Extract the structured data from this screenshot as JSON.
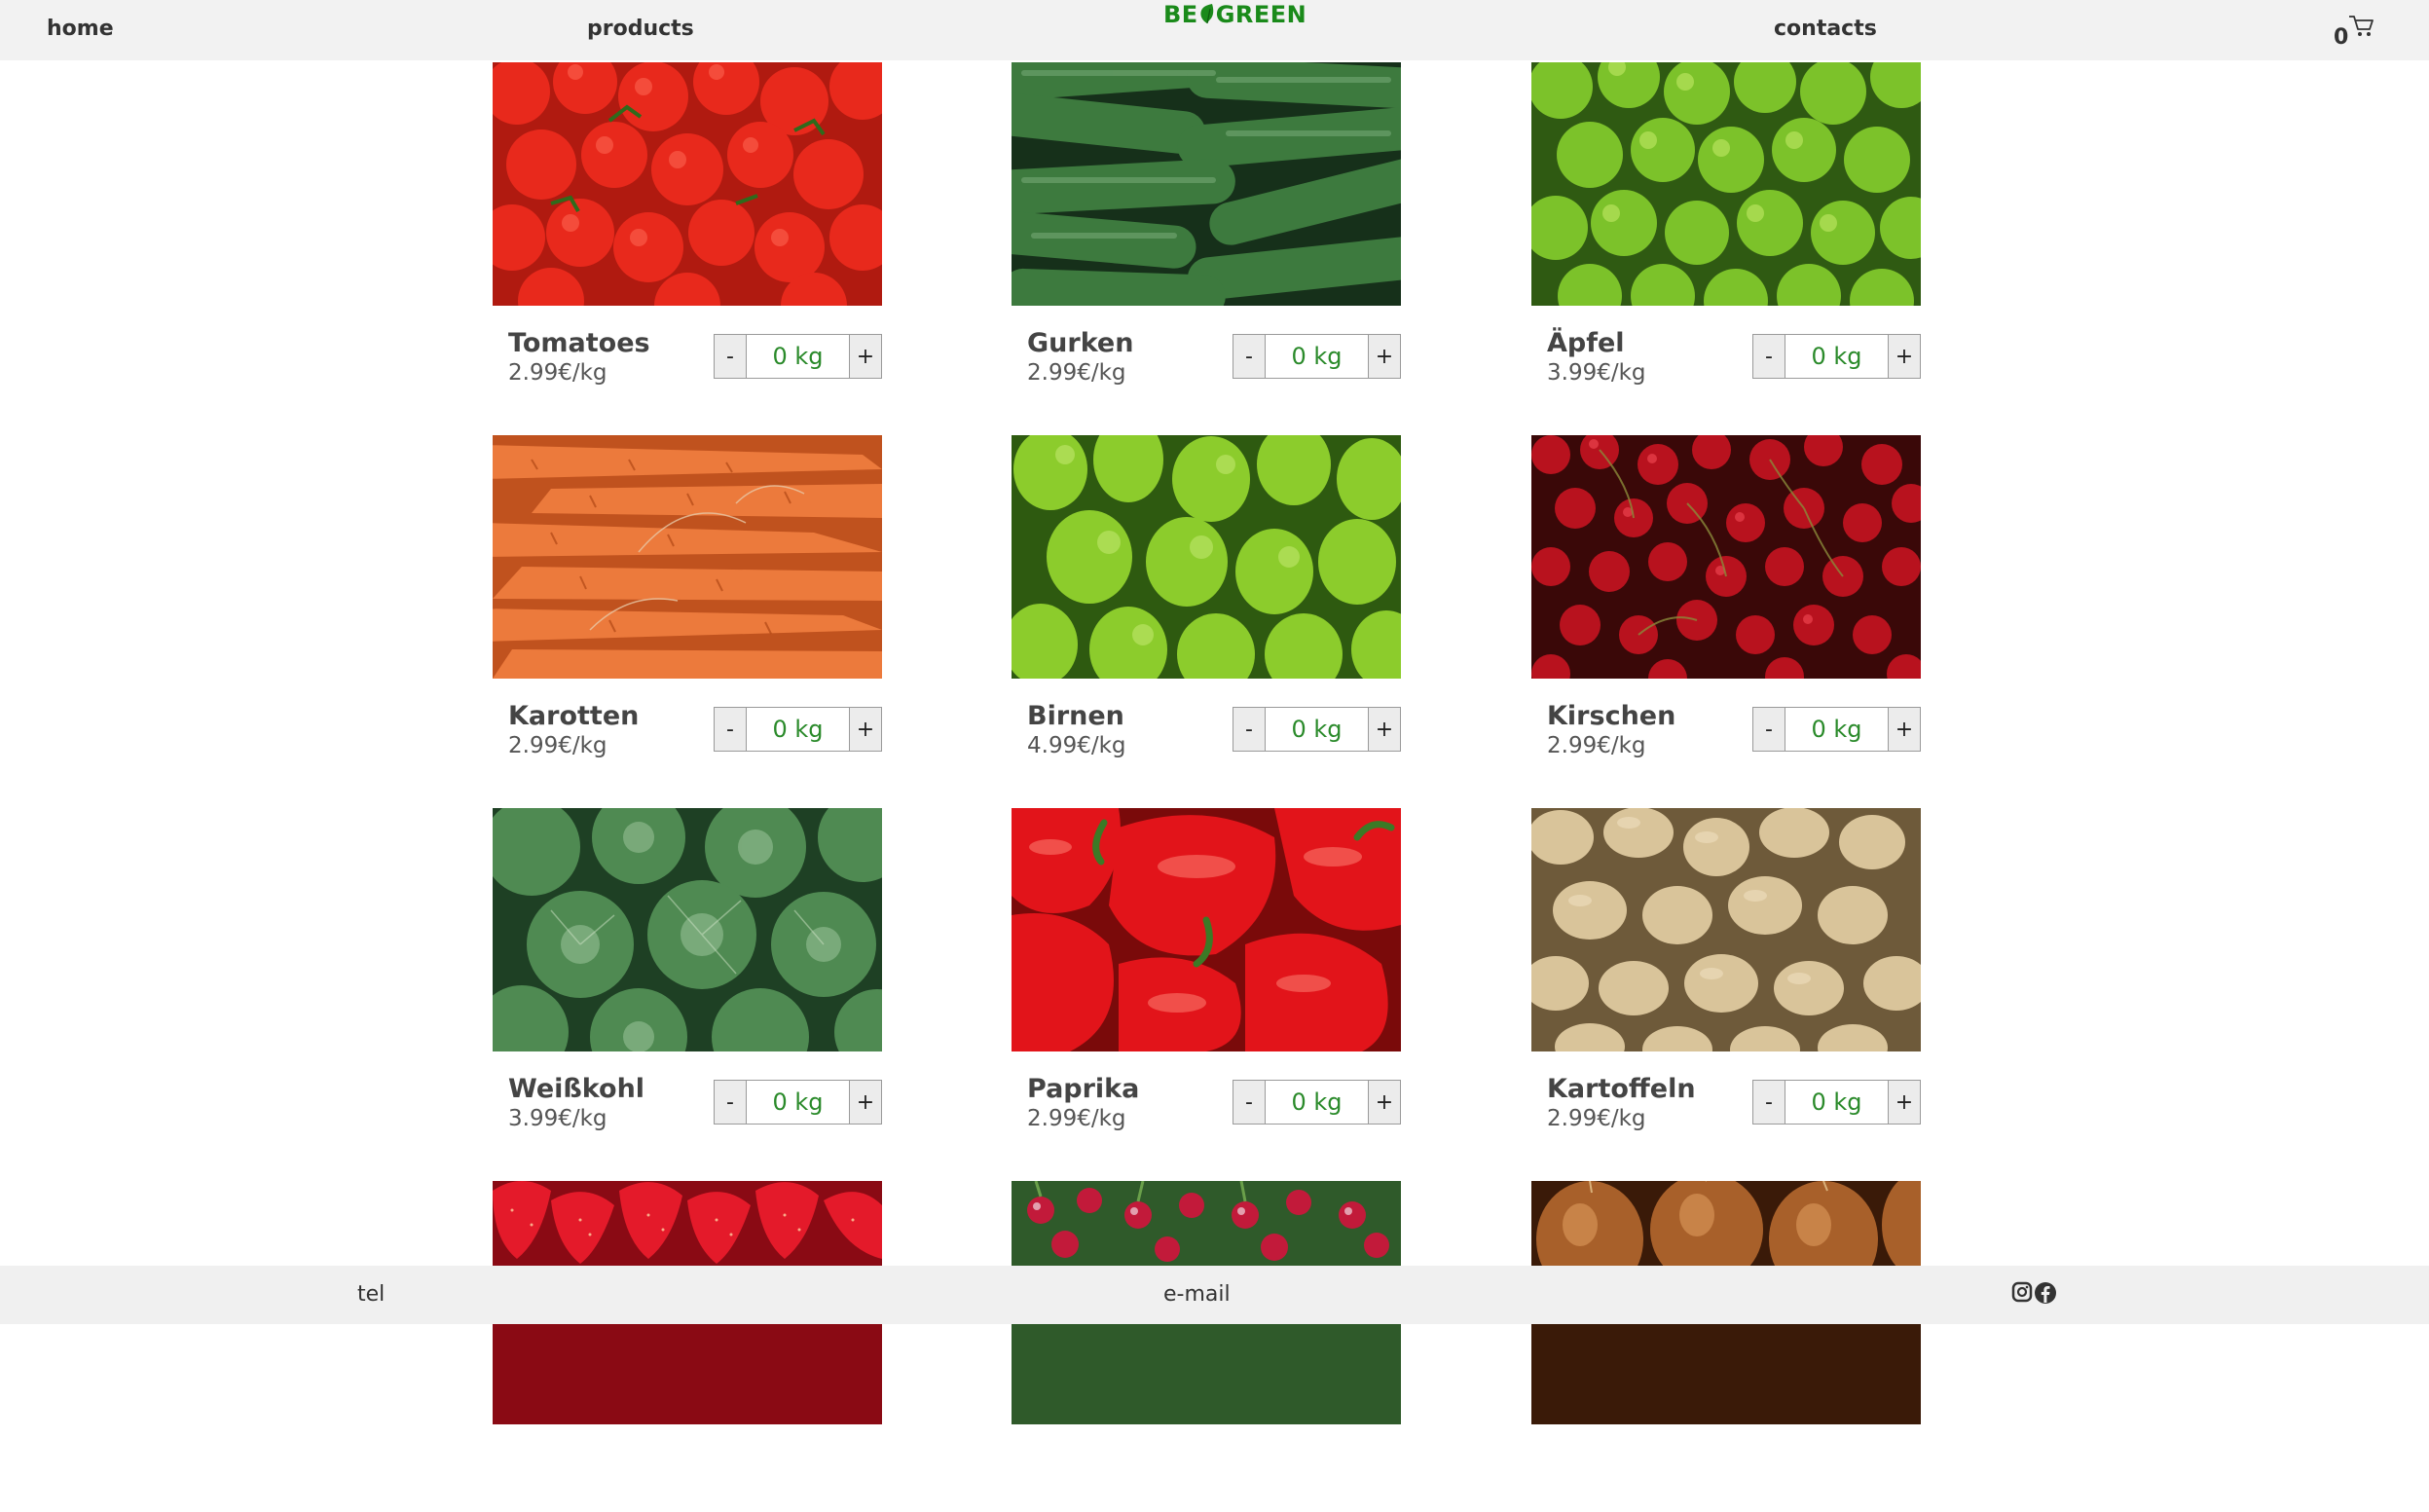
{
  "header": {
    "nav_home": "home",
    "nav_products": "products",
    "nav_contacts": "contacts",
    "logo_left": "BE",
    "logo_right": "GREEN",
    "logo_icon": "leaf-icon",
    "cart_count": "0",
    "cart_icon": "cart-icon"
  },
  "products": [
    {
      "name": "Tomatoes",
      "price": "2.99€/kg",
      "qty": "0 kg",
      "minus": "-",
      "plus": "+",
      "image": "tomatoes"
    },
    {
      "name": "Gurken",
      "price": "2.99€/kg",
      "qty": "0 kg",
      "minus": "-",
      "plus": "+",
      "image": "cucumbers"
    },
    {
      "name": "Äpfel",
      "price": "3.99€/kg",
      "qty": "0 kg",
      "minus": "-",
      "plus": "+",
      "image": "apples"
    },
    {
      "name": "Karotten",
      "price": "2.99€/kg",
      "qty": "0 kg",
      "minus": "-",
      "plus": "+",
      "image": "carrots"
    },
    {
      "name": "Birnen",
      "price": "4.99€/kg",
      "qty": "0 kg",
      "minus": "-",
      "plus": "+",
      "image": "pears"
    },
    {
      "name": "Kirschen",
      "price": "2.99€/kg",
      "qty": "0 kg",
      "minus": "-",
      "plus": "+",
      "image": "cherries"
    },
    {
      "name": "Weißkohl",
      "price": "3.99€/kg",
      "qty": "0 kg",
      "minus": "-",
      "plus": "+",
      "image": "cabbage"
    },
    {
      "name": "Paprika",
      "price": "2.99€/kg",
      "qty": "0 kg",
      "minus": "-",
      "plus": "+",
      "image": "peppers"
    },
    {
      "name": "Kartoffeln",
      "price": "2.99€/kg",
      "qty": "0 kg",
      "minus": "-",
      "plus": "+",
      "image": "potatoes"
    }
  ],
  "partial_images": [
    "strawberries",
    "radishes",
    "onions"
  ],
  "footer": {
    "tel": "tel",
    "email": "e-mail",
    "instagram_icon": "instagram-icon",
    "facebook_icon": "facebook-icon"
  },
  "colors": {
    "brand_green": "#1a8a1a",
    "qty_text": "#2a8a2a",
    "bar_bg": "#f2f2f2"
  }
}
